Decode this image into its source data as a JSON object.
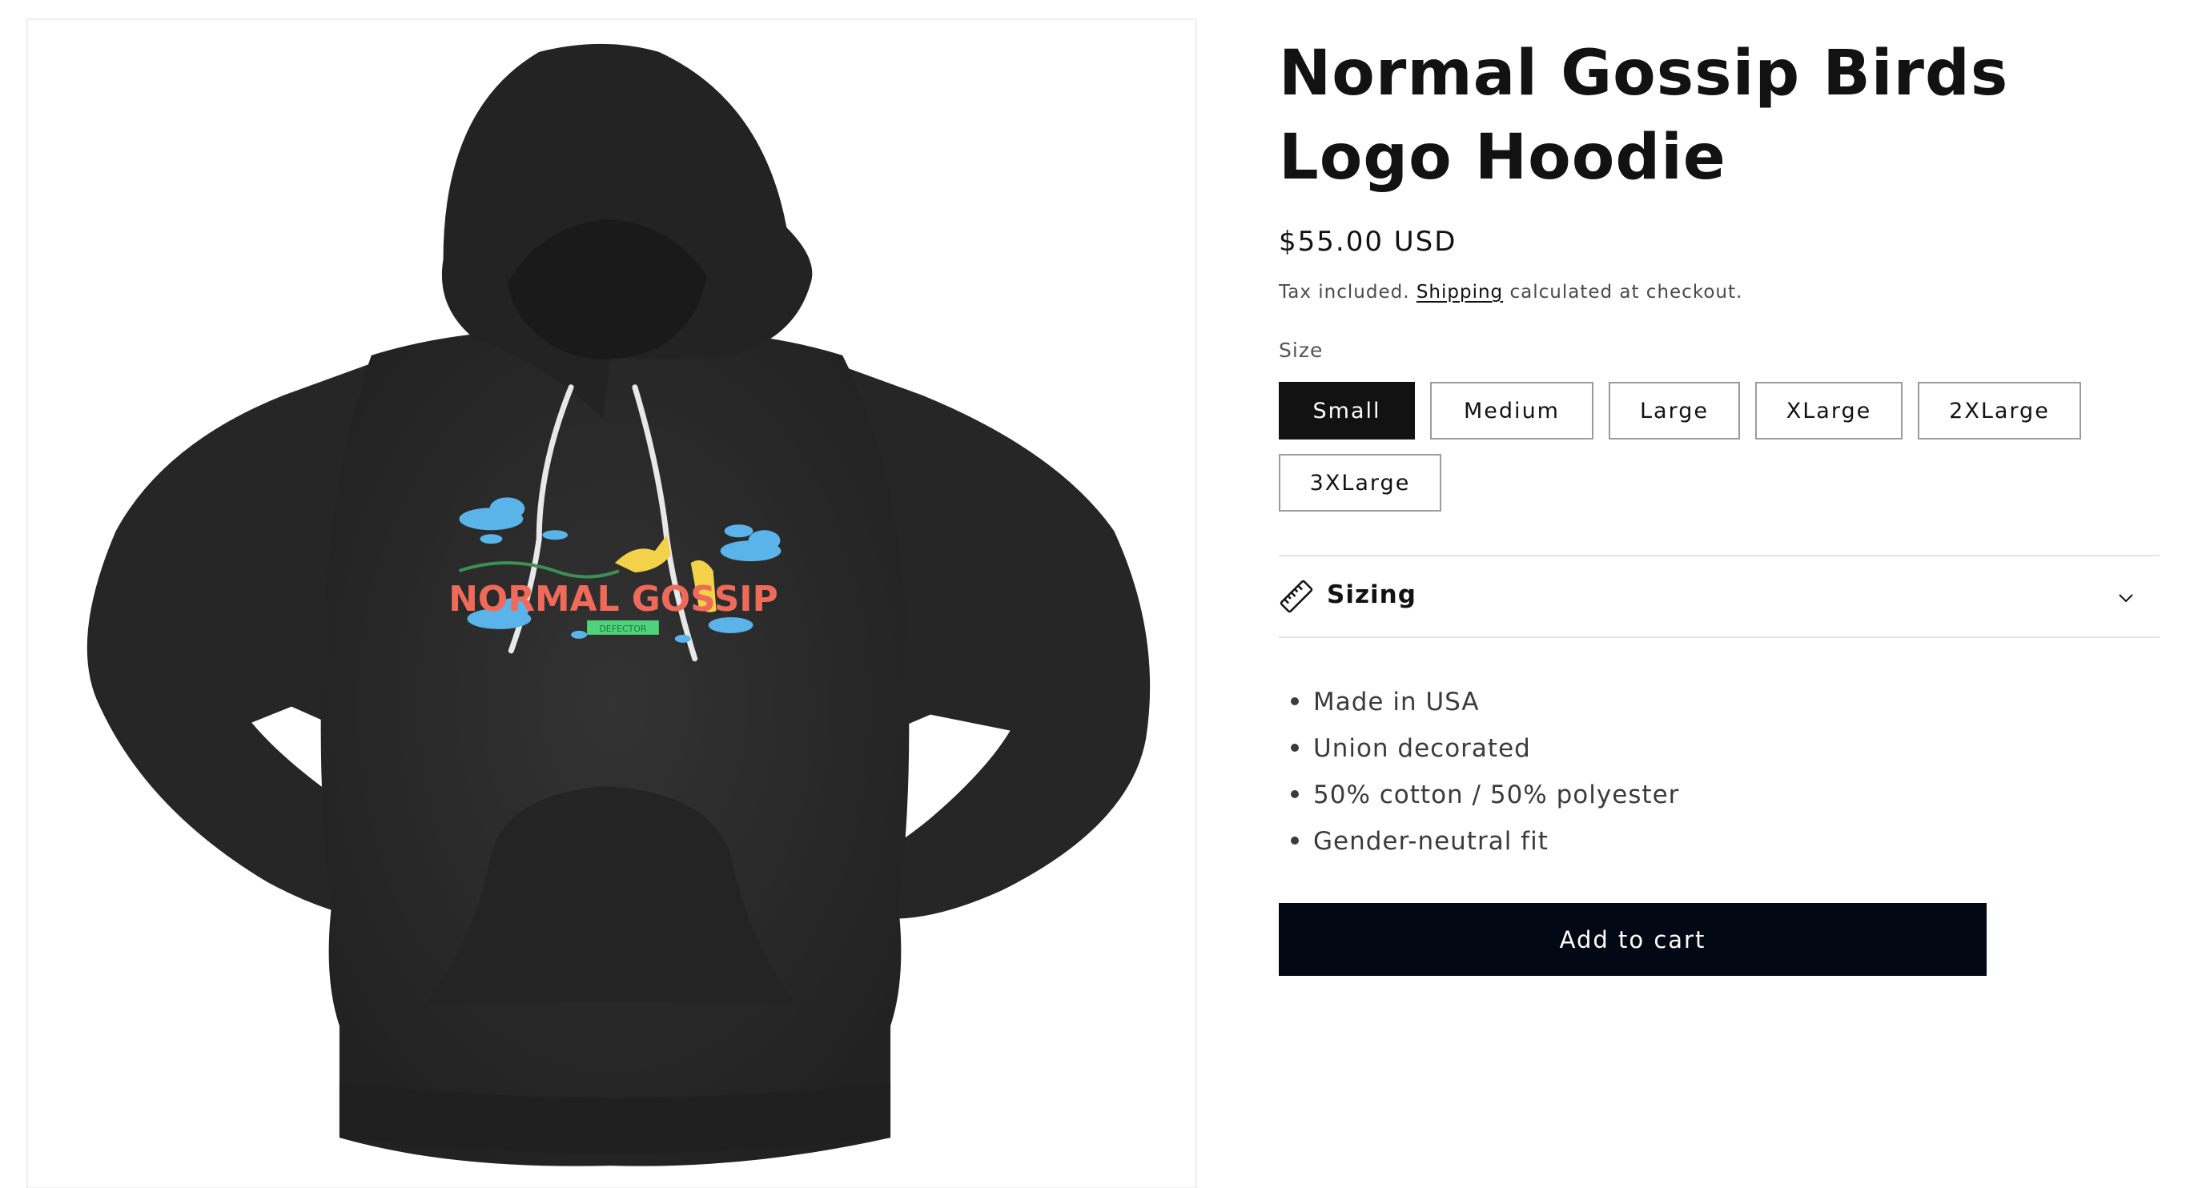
{
  "product": {
    "title": "Normal Gossip Birds Logo Hoodie",
    "price": "$55.00 USD",
    "tax_note": {
      "prefix": "Tax included.",
      "link": "Shipping",
      "suffix": "calculated at checkout."
    },
    "image": {
      "print_text": "NORMAL GOSSIP",
      "print_subtext": "DEFECTOR"
    }
  },
  "size": {
    "label": "Size",
    "selected": "Small",
    "options": [
      "Small",
      "Medium",
      "Large",
      "XLarge",
      "2XLarge",
      "3XLarge"
    ]
  },
  "accordion": {
    "title": "Sizing",
    "icon": "ruler-icon",
    "expand_icon": "chevron-down-icon"
  },
  "features": [
    "Made in USA",
    "Union decorated",
    "50% cotton / 50% polyester",
    "Gender-neutral fit"
  ],
  "cart": {
    "add_label": "Add to cart"
  },
  "colors": {
    "primary": "#121212",
    "button": "#020814",
    "hoodie": "#2a2a2a",
    "print_red": "#f06a5a",
    "print_blue": "#5ab4ea",
    "print_yellow": "#f3d24a",
    "print_green": "#4fd37a"
  }
}
